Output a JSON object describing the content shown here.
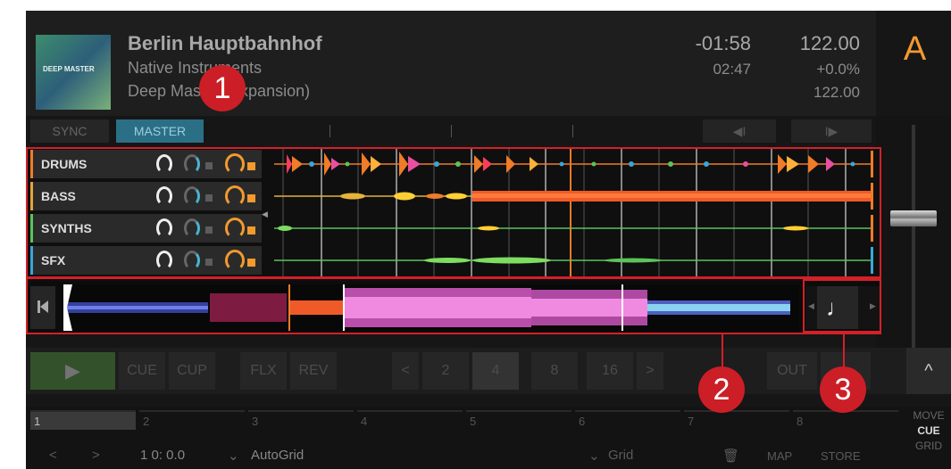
{
  "header": {
    "cover_label": "DEEP MASTER",
    "title": "Berlin Hauptbahnhof",
    "artist": "Native Instruments",
    "album": "Deep Master (Expansion)",
    "time_remaining": "-01:58",
    "time_elapsed": "02:47",
    "bpm": "122.00",
    "pitch": "+0.0%",
    "original_bpm": "122.00",
    "deck_letter": "A"
  },
  "topbar": {
    "sync_label": "SYNC",
    "master_label": "MASTER",
    "jump_back_label": "◀I",
    "jump_fwd_label": "I▶"
  },
  "stems": [
    {
      "name": "DRUMS",
      "color": "#f07b28"
    },
    {
      "name": "BASS",
      "color": "#e6a23a"
    },
    {
      "name": "SYNTHS",
      "color": "#5cc35a"
    },
    {
      "name": "SFX",
      "color": "#3aa6d8"
    }
  ],
  "transport": {
    "play_icon": "play-icon",
    "cue_label": "CUE",
    "cup_label": "CUP",
    "flx_label": "FLX",
    "rev_label": "REV",
    "loop_prev": "<",
    "loop_sizes": [
      "2",
      "4",
      "8",
      "16"
    ],
    "loop_next": ">",
    "out_label": "OUT",
    "up_icon": "^"
  },
  "cues": {
    "slots": [
      "1",
      "2",
      "3",
      "4",
      "5",
      "6",
      "7",
      "8"
    ],
    "prev_arrow": "<",
    "next_arrow": ">",
    "position": "1 0: 0.0",
    "autogrid_label": "AutoGrid",
    "grid_label": "Grid",
    "map_label": "MAP",
    "store_label": "STORE",
    "move_label": "MOVE",
    "cue_mode_label": "CUE",
    "grid_mode_label": "GRID"
  },
  "callouts": {
    "one": "1",
    "two": "2",
    "three": "3"
  },
  "colors": {
    "accent": "#f29a2e",
    "callout_red": "#d42027",
    "master_blue": "#2b6f86"
  }
}
